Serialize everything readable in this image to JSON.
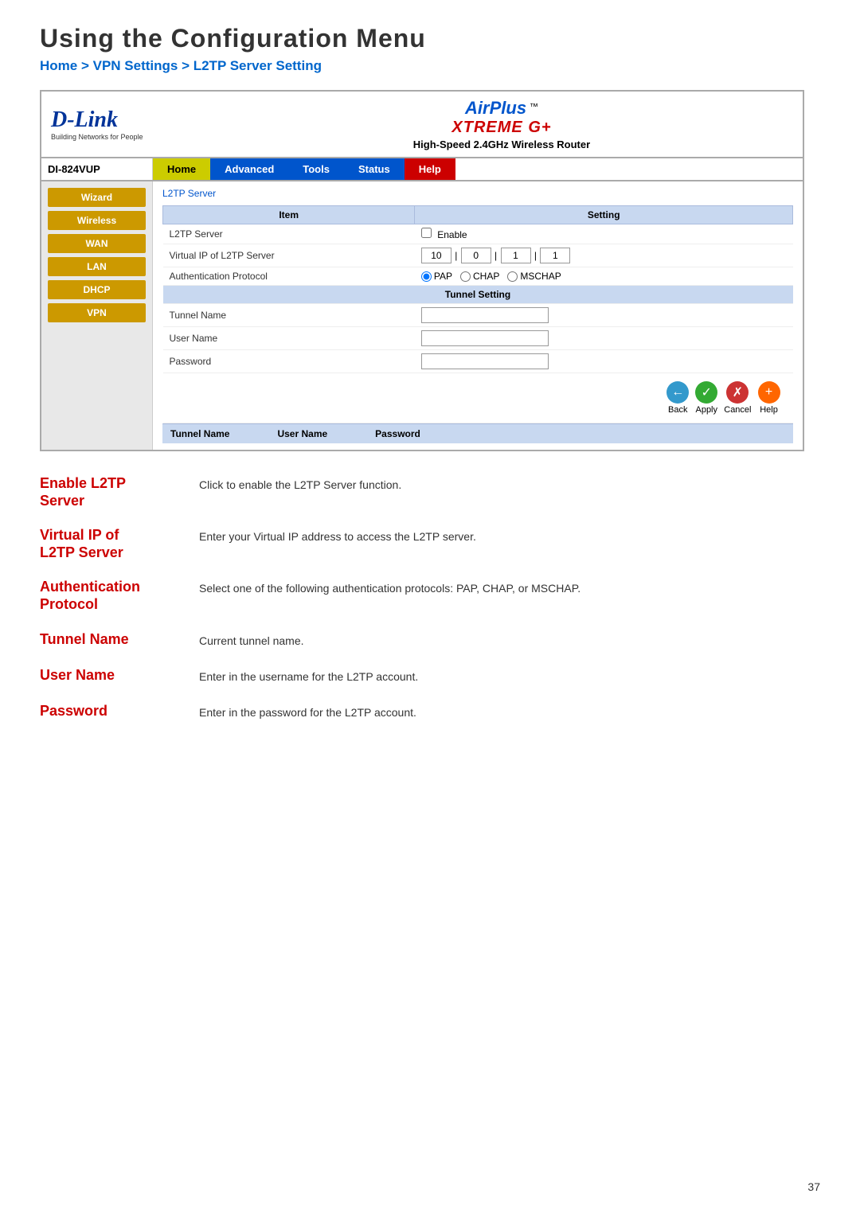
{
  "page": {
    "main_title": "Using the Configuration Menu",
    "subtitle": "Home > VPN Settings > L2TP Server Setting",
    "page_number": "37"
  },
  "router": {
    "brand": "D-Link",
    "tagline": "Building Networks for People",
    "airplus": "AirPlus",
    "xtreme": "XTREME G+",
    "tm": "™",
    "model_description": "High-Speed 2.4GHz Wireless Router",
    "device_name": "DI-824VUP"
  },
  "nav": {
    "tabs": [
      {
        "label": "Home",
        "class": "home"
      },
      {
        "label": "Advanced",
        "class": "advanced"
      },
      {
        "label": "Tools",
        "class": "tools"
      },
      {
        "label": "Status",
        "class": "status"
      },
      {
        "label": "Help",
        "class": "help"
      }
    ]
  },
  "sidebar": {
    "buttons": [
      {
        "label": "Wizard",
        "class": "wizard"
      },
      {
        "label": "Wireless",
        "class": "wireless"
      },
      {
        "label": "WAN",
        "class": "wan"
      },
      {
        "label": "LAN",
        "class": "lan"
      },
      {
        "label": "DHCP",
        "class": "dhcp"
      },
      {
        "label": "VPN",
        "class": "vpn"
      }
    ]
  },
  "breadcrumb": "L2TP Server",
  "table": {
    "header": {
      "item_col": "Item",
      "setting_col": "Setting"
    },
    "rows": [
      {
        "label": "L2TP Server",
        "value_type": "checkbox",
        "value_text": "Enable"
      },
      {
        "label": "Virtual IP of L2TP Server",
        "value_type": "ip",
        "ip_parts": [
          "10",
          "0",
          "1",
          "1"
        ]
      },
      {
        "label": "Authentication Protocol",
        "value_type": "radio",
        "options": [
          "PAP",
          "CHAP",
          "MSCHAP"
        ],
        "selected": "PAP"
      }
    ],
    "tunnel_header": "Tunnel Setting",
    "tunnel_rows": [
      {
        "label": "Tunnel Name",
        "value_type": "text"
      },
      {
        "label": "User Name",
        "value_type": "text"
      },
      {
        "label": "Password",
        "value_type": "text"
      }
    ]
  },
  "actions": [
    {
      "label": "Back",
      "icon": "←",
      "class": "back-icon"
    },
    {
      "label": "Apply",
      "icon": "✓",
      "class": "apply-icon"
    },
    {
      "label": "Cancel",
      "icon": "✕",
      "class": "cancel-icon"
    },
    {
      "label": "Help",
      "icon": "+",
      "class": "help-icon"
    }
  ],
  "footer_cols": [
    "Tunnel Name",
    "User Name",
    "Password"
  ],
  "descriptions": [
    {
      "label": "Enable L2TP\nServer",
      "text": "Click to enable the L2TP Server function."
    },
    {
      "label": "Virtual IP of\nL2TP Server",
      "text": "Enter your Virtual IP address to access the L2TP server."
    },
    {
      "label": "Authentication\nProtocol",
      "text": "Select one of the following authentication protocols: PAP, CHAP, or MSCHAP."
    },
    {
      "label": "Tunnel Name",
      "text": "Current tunnel name."
    },
    {
      "label": "User Name",
      "text": "Enter in the username for the L2TP account."
    },
    {
      "label": "Password",
      "text": "Enter in the password for the L2TP account."
    }
  ]
}
